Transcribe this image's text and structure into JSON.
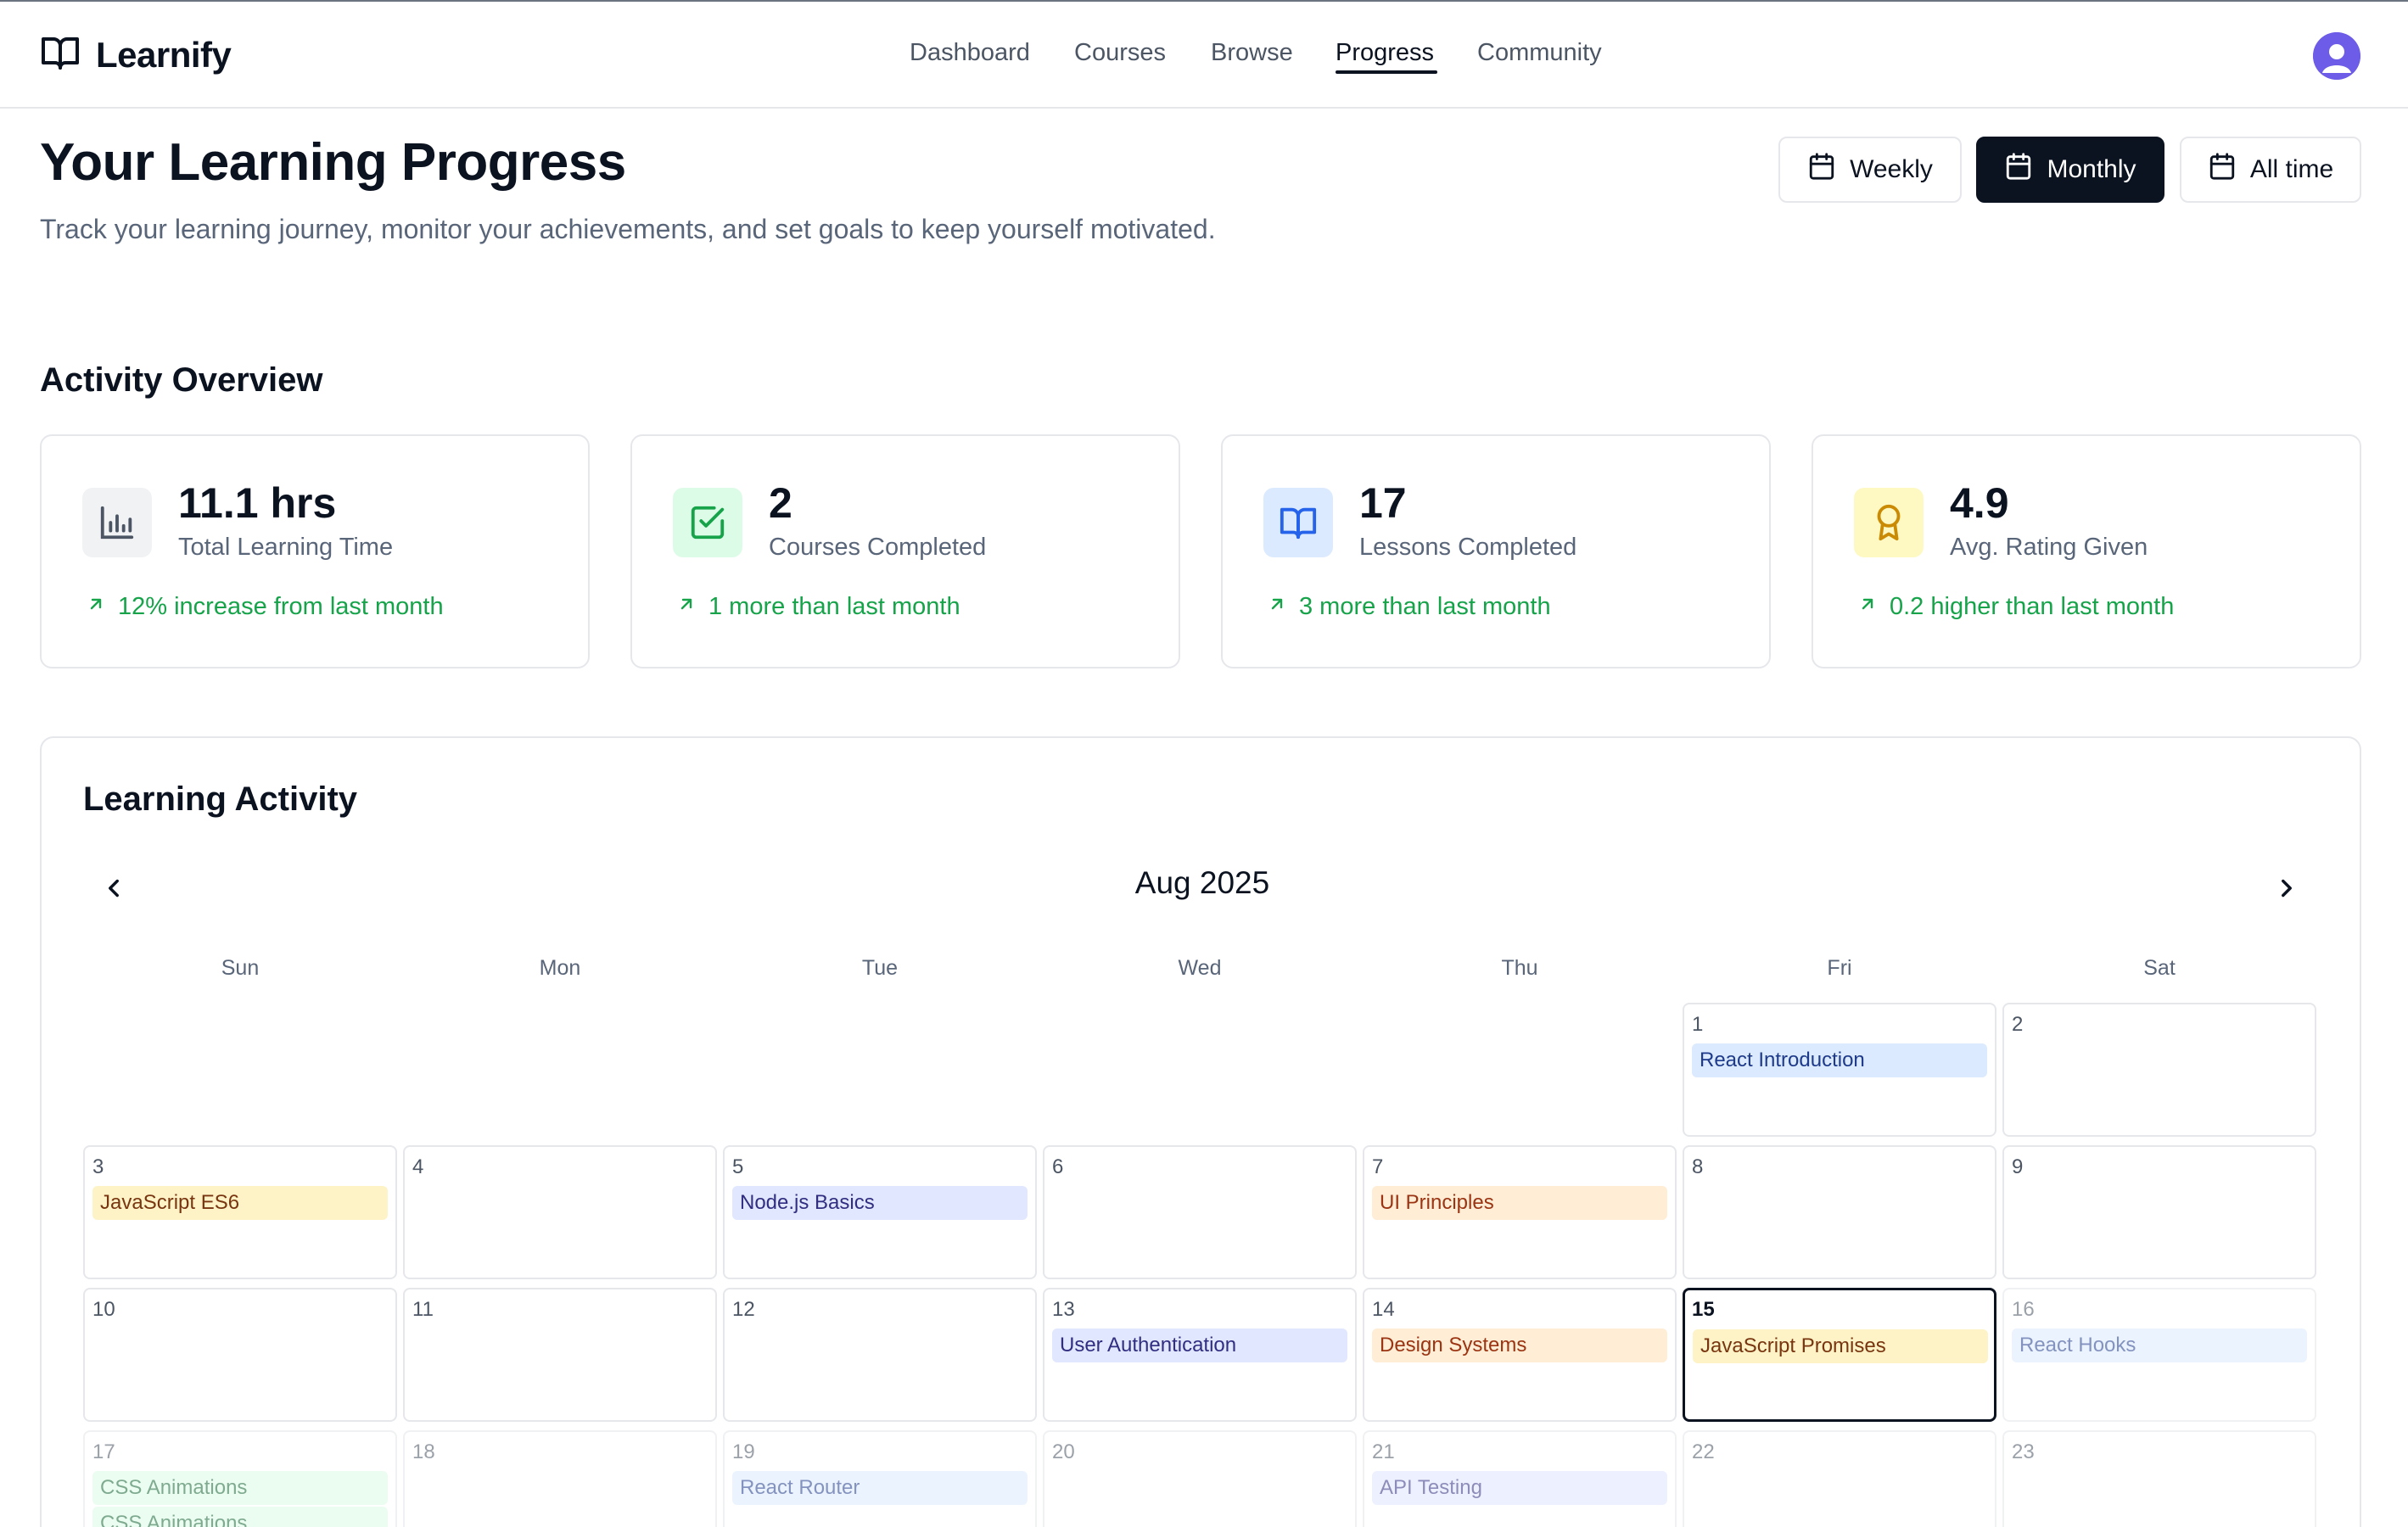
{
  "app": {
    "name": "Learnify",
    "logo_icon": "book-open-icon"
  },
  "nav": {
    "items": [
      {
        "label": "Dashboard",
        "active": false
      },
      {
        "label": "Courses",
        "active": false
      },
      {
        "label": "Browse",
        "active": false
      },
      {
        "label": "Progress",
        "active": true
      },
      {
        "label": "Community",
        "active": false
      }
    ]
  },
  "user": {
    "avatar_icon": "user-avatar-icon",
    "avatar_color": "#6d5ce7"
  },
  "page": {
    "title": "Your Learning Progress",
    "subtitle": "Track your learning journey, monitor your achievements, and set goals to keep yourself motivated."
  },
  "range": {
    "options": [
      {
        "label": "Weekly",
        "icon": "calendar-icon",
        "active": false
      },
      {
        "label": "Monthly",
        "icon": "calendar-icon",
        "active": true
      },
      {
        "label": "All time",
        "icon": "calendar-icon",
        "active": false
      }
    ]
  },
  "overview": {
    "title": "Activity Overview",
    "stats": [
      {
        "value": "11.1 hrs",
        "label": "Total Learning Time",
        "trend": "12% increase from last month",
        "icon": "bar-chart-icon",
        "icon_bg": "#f1f2f4",
        "icon_color": "#4b5563"
      },
      {
        "value": "2",
        "label": "Courses Completed",
        "trend": "1 more than last month",
        "icon": "check-square-icon",
        "icon_bg": "#dcfce7",
        "icon_color": "#16a34a"
      },
      {
        "value": "17",
        "label": "Lessons Completed",
        "trend": "3 more than last month",
        "icon": "book-open-icon",
        "icon_bg": "#dbeafe",
        "icon_color": "#2563eb"
      },
      {
        "value": "4.9",
        "label": "Avg. Rating Given",
        "trend": "0.2 higher than last month",
        "icon": "award-icon",
        "icon_bg": "#fef9c3",
        "icon_color": "#ca8a04"
      }
    ],
    "trend_color": "#16a34a"
  },
  "activity": {
    "title": "Learning Activity",
    "month": "Aug 2025",
    "weekdays": [
      "Sun",
      "Mon",
      "Tue",
      "Wed",
      "Thu",
      "Fri",
      "Sat"
    ],
    "today": 15,
    "weeks": [
      [
        null,
        null,
        null,
        null,
        null,
        {
          "day": "1",
          "events": [
            {
              "title": "React Introduction",
              "color": "blue"
            }
          ]
        },
        {
          "day": "2",
          "events": []
        }
      ],
      [
        {
          "day": "3",
          "events": [
            {
              "title": "JavaScript ES6",
              "color": "yellow"
            }
          ]
        },
        {
          "day": "4",
          "events": []
        },
        {
          "day": "5",
          "events": [
            {
              "title": "Node.js Basics",
              "color": "indigo"
            }
          ]
        },
        {
          "day": "6",
          "events": []
        },
        {
          "day": "7",
          "events": [
            {
              "title": "UI Principles",
              "color": "orange"
            }
          ]
        },
        {
          "day": "8",
          "events": []
        },
        {
          "day": "9",
          "events": []
        }
      ],
      [
        {
          "day": "10",
          "events": []
        },
        {
          "day": "11",
          "events": []
        },
        {
          "day": "12",
          "events": []
        },
        {
          "day": "13",
          "events": [
            {
              "title": "User Authentication",
              "color": "indigo"
            }
          ]
        },
        {
          "day": "14",
          "events": [
            {
              "title": "Design Systems",
              "color": "orange"
            }
          ]
        },
        {
          "day": "15",
          "events": [
            {
              "title": "JavaScript Promises",
              "color": "yellow"
            }
          ]
        },
        {
          "day": "16",
          "events": [
            {
              "title": "React Hooks",
              "color": "blue"
            }
          ]
        }
      ],
      [
        {
          "day": "17",
          "events": [
            {
              "title": "CSS Animations",
              "color": "green"
            },
            {
              "title": "CSS Animations",
              "color": "green"
            }
          ]
        },
        {
          "day": "18",
          "events": []
        },
        {
          "day": "19",
          "events": [
            {
              "title": "React Router",
              "color": "blue"
            }
          ]
        },
        {
          "day": "20",
          "events": []
        },
        {
          "day": "21",
          "events": [
            {
              "title": "API Testing",
              "color": "indigo"
            }
          ]
        },
        {
          "day": "22",
          "events": []
        },
        {
          "day": "23",
          "events": []
        }
      ]
    ]
  }
}
